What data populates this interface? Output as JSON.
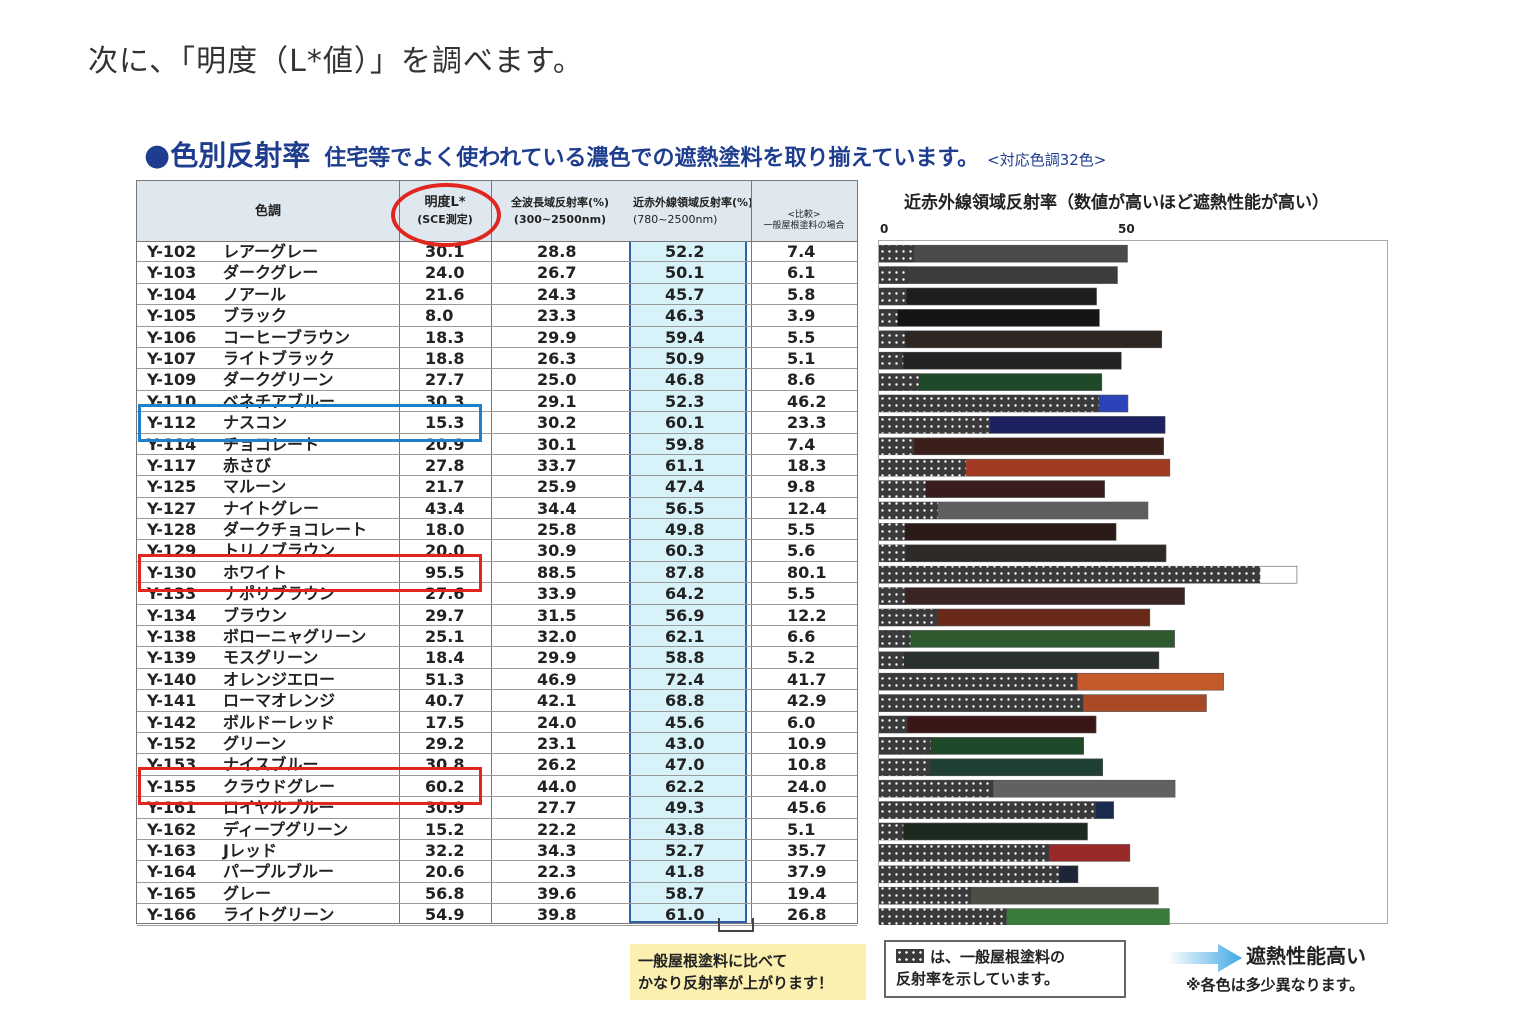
{
  "intro_text": "次に、「明度（L*値）」を調べます。",
  "heading": {
    "bullet": "●",
    "title": "色別反射率",
    "subtitle": "住宅等でよく使われている濃色での遮熱塗料を取り揃えています。",
    "note": "<対応色調32色>"
  },
  "table": {
    "headers": {
      "color": "色調",
      "lightness": "明度L*",
      "lightness_sub": "(SCE測定)",
      "full": "全波長域反射率(%)",
      "full_sub": "(300~2500nm)",
      "nir": "近赤外線領域反射率(%)",
      "nir_sub": "(780~2500nm)",
      "cmp": "<比較>",
      "cmp_sub": "一般屋根塗料の場合"
    }
  },
  "chart_data": {
    "type": "bar",
    "title": "近赤外線領域反射率（数値が高いほど遮熱性能が高い）",
    "xlim": [
      0,
      100
    ],
    "x_ticks": [
      "0",
      "50"
    ],
    "series": [
      {
        "name": "遮熱塗料",
        "values": [
          52.2,
          50.1,
          45.7,
          46.3,
          59.4,
          50.9,
          46.8,
          52.3,
          60.1,
          59.8,
          61.1,
          47.4,
          56.5,
          49.8,
          60.3,
          87.8,
          64.2,
          56.9,
          62.1,
          58.8,
          72.4,
          68.8,
          45.6,
          43.0,
          47.0,
          62.2,
          49.3,
          43.8,
          52.7,
          41.8,
          58.7,
          61.0
        ]
      },
      {
        "name": "一般屋根塗料",
        "values": [
          7.4,
          6.1,
          5.8,
          3.9,
          5.5,
          5.1,
          8.6,
          46.2,
          23.3,
          7.4,
          18.3,
          9.8,
          12.4,
          5.5,
          5.6,
          80.1,
          5.5,
          12.2,
          6.6,
          5.2,
          41.7,
          42.9,
          6.0,
          10.9,
          10.8,
          24.0,
          45.6,
          5.1,
          35.7,
          37.9,
          19.4,
          26.8
        ]
      }
    ],
    "rows": [
      {
        "code": "Y-102",
        "name": "レアーグレー",
        "l": "30.1",
        "full": "28.8",
        "nir": "52.2",
        "cmp": "7.4",
        "color": "#4a4a4a"
      },
      {
        "code": "Y-103",
        "name": "ダークグレー",
        "l": "24.0",
        "full": "26.7",
        "nir": "50.1",
        "cmp": "6.1",
        "color": "#3c3c3c"
      },
      {
        "code": "Y-104",
        "name": "ノアール",
        "l": "21.6",
        "full": "24.3",
        "nir": "45.7",
        "cmp": "5.8",
        "color": "#1e1e1e"
      },
      {
        "code": "Y-105",
        "name": "ブラック",
        "l": "8.0",
        "full": "23.3",
        "nir": "46.3",
        "cmp": "3.9",
        "color": "#151515"
      },
      {
        "code": "Y-106",
        "name": "コーヒーブラウン",
        "l": "18.3",
        "full": "29.9",
        "nir": "59.4",
        "cmp": "5.5",
        "color": "#2e2622"
      },
      {
        "code": "Y-107",
        "name": "ライトブラック",
        "l": "18.8",
        "full": "26.3",
        "nir": "50.9",
        "cmp": "5.1",
        "color": "#222222"
      },
      {
        "code": "Y-109",
        "name": "ダークグリーン",
        "l": "27.7",
        "full": "25.0",
        "nir": "46.8",
        "cmp": "8.6",
        "color": "#1f4a2a"
      },
      {
        "code": "Y-110",
        "name": "ベネチアブルー",
        "l": "30.3",
        "full": "29.1",
        "nir": "52.3",
        "cmp": "46.2",
        "color": "#2a43b8"
      },
      {
        "code": "Y-112",
        "name": "ナスコン",
        "l": "15.3",
        "full": "30.2",
        "nir": "60.1",
        "cmp": "23.3",
        "color": "#1c2260"
      },
      {
        "code": "Y-114",
        "name": "チョコレート",
        "l": "20.9",
        "full": "30.1",
        "nir": "59.8",
        "cmp": "7.4",
        "color": "#3a1f1a"
      },
      {
        "code": "Y-117",
        "name": "赤さび",
        "l": "27.8",
        "full": "33.7",
        "nir": "61.1",
        "cmp": "18.3",
        "color": "#a23a24"
      },
      {
        "code": "Y-125",
        "name": "マルーン",
        "l": "21.7",
        "full": "25.9",
        "nir": "47.4",
        "cmp": "9.8",
        "color": "#3a1c1c"
      },
      {
        "code": "Y-127",
        "name": "ナイトグレー",
        "l": "43.4",
        "full": "34.4",
        "nir": "56.5",
        "cmp": "12.4",
        "color": "#5e5e5e"
      },
      {
        "code": "Y-128",
        "name": "ダークチョコレート",
        "l": "18.0",
        "full": "25.8",
        "nir": "49.8",
        "cmp": "5.5",
        "color": "#2a1a18"
      },
      {
        "code": "Y-129",
        "name": "トリノブラウン",
        "l": "20.0",
        "full": "30.9",
        "nir": "60.3",
        "cmp": "5.6",
        "color": "#2e2a28"
      },
      {
        "code": "Y-130",
        "name": "ホワイト",
        "l": "95.5",
        "full": "88.5",
        "nir": "87.8",
        "cmp": "80.1",
        "color": "#ffffff"
      },
      {
        "code": "Y-133",
        "name": "ナポリブラウン",
        "l": "27.6",
        "full": "33.9",
        "nir": "64.2",
        "cmp": "5.5",
        "color": "#3a2522"
      },
      {
        "code": "Y-134",
        "name": "ブラウン",
        "l": "29.7",
        "full": "31.5",
        "nir": "56.9",
        "cmp": "12.2",
        "color": "#6a2a1a"
      },
      {
        "code": "Y-138",
        "name": "ボローニャグリーン",
        "l": "25.1",
        "full": "32.0",
        "nir": "62.1",
        "cmp": "6.6",
        "color": "#2f5a30"
      },
      {
        "code": "Y-139",
        "name": "モスグリーン",
        "l": "18.4",
        "full": "29.9",
        "nir": "58.8",
        "cmp": "5.2",
        "color": "#2a302c"
      },
      {
        "code": "Y-140",
        "name": "オレンジエロー",
        "l": "51.3",
        "full": "46.9",
        "nir": "72.4",
        "cmp": "41.7",
        "color": "#c4592a"
      },
      {
        "code": "Y-141",
        "name": "ローマオレンジ",
        "l": "40.7",
        "full": "42.1",
        "nir": "68.8",
        "cmp": "42.9",
        "color": "#a84a26"
      },
      {
        "code": "Y-142",
        "name": "ボルドーレッド",
        "l": "17.5",
        "full": "24.0",
        "nir": "45.6",
        "cmp": "6.0",
        "color": "#3a1616"
      },
      {
        "code": "Y-152",
        "name": "グリーン",
        "l": "29.2",
        "full": "23.1",
        "nir": "43.0",
        "cmp": "10.9",
        "color": "#1e4a2a"
      },
      {
        "code": "Y-153",
        "name": "ナイスブルー",
        "l": "30.8",
        "full": "26.2",
        "nir": "47.0",
        "cmp": "10.8",
        "color": "#1f3f34"
      },
      {
        "code": "Y-155",
        "name": "クラウドグレー",
        "l": "60.2",
        "full": "44.0",
        "nir": "62.2",
        "cmp": "24.0",
        "color": "#5f625e"
      },
      {
        "code": "Y-161",
        "name": "ロイヤルブルー",
        "l": "30.9",
        "full": "27.7",
        "nir": "49.3",
        "cmp": "45.6",
        "color": "#1a2a50"
      },
      {
        "code": "Y-162",
        "name": "ディープグリーン",
        "l": "15.2",
        "full": "22.2",
        "nir": "43.8",
        "cmp": "5.1",
        "color": "#1c2a20"
      },
      {
        "code": "Y-163",
        "name": "Jレッド",
        "l": "32.2",
        "full": "34.3",
        "nir": "52.7",
        "cmp": "35.7",
        "color": "#9a2a2a"
      },
      {
        "code": "Y-164",
        "name": "パープルブルー",
        "l": "20.6",
        "full": "22.3",
        "nir": "41.8",
        "cmp": "37.9",
        "color": "#1c2436"
      },
      {
        "code": "Y-165",
        "name": "グレー",
        "l": "56.8",
        "full": "39.6",
        "nir": "58.7",
        "cmp": "19.4",
        "color": "#4e4e46"
      },
      {
        "code": "Y-166",
        "name": "ライトグリーン",
        "l": "54.9",
        "full": "39.8",
        "nir": "61.0",
        "cmp": "26.8",
        "color": "#3a7a3a"
      }
    ]
  },
  "footer": {
    "yellow_line1": "一般屋根塗料に比べて",
    "yellow_line2": "かなり反射率が上がります！",
    "legend_line1": "は、一般屋根塗料の",
    "legend_line2": "反射率を示しています。",
    "performance": "遮熱性能高い",
    "performance_note": "※各色は多少異なります。"
  },
  "colors": {
    "heading": "#1f3d8f",
    "highlight_red": "#e0261f",
    "highlight_blue": "#1f7fc9",
    "nir_band": "#d8f2fa",
    "arrow": "#3fa7e6"
  }
}
